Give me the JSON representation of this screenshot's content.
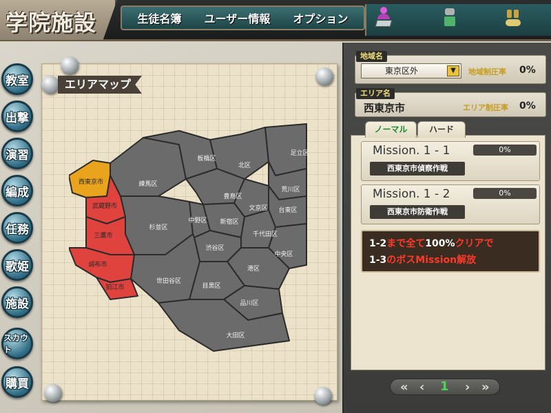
{
  "app": {
    "title": "学院施設"
  },
  "top_menu": {
    "items": [
      "生徒名簿",
      "ユーザー情報",
      "オプション"
    ]
  },
  "side_menu": {
    "items": [
      "教室",
      "出撃",
      "演習",
      "編成",
      "任務",
      "歌姫",
      "施設",
      "スカウト",
      "購買"
    ]
  },
  "map": {
    "label": "エリアマップ",
    "regions": [
      "西東京市",
      "武蔵野市",
      "三鷹市",
      "調布市",
      "狛江市",
      "練馬区",
      "杉並区",
      "世田谷区",
      "板橋区",
      "北区",
      "足立区",
      "荒川区",
      "豊島区",
      "文京区",
      "台東区",
      "中野区",
      "新宿区",
      "千代田区",
      "中央区",
      "渋谷区",
      "港区",
      "目黒区",
      "品川区",
      "大田区"
    ]
  },
  "region_panel": {
    "region_tag": "地域名",
    "region_value": "東京区外",
    "region_rate_label": "地域制圧率",
    "region_rate_value": "0%",
    "area_tag": "エリア名",
    "area_value": "西東京市",
    "area_rate_label": "エリア制圧率",
    "area_rate_value": "0%"
  },
  "tabs": {
    "normal": "ノーマル",
    "hard": "ハード",
    "separator": "|"
  },
  "missions": [
    {
      "title": "Mission. 1 - 1",
      "subtitle": "西東京市偵察作戦",
      "progress": "0%"
    },
    {
      "title": "Mission. 1 - 2",
      "subtitle": "西東京市防衛作戦",
      "progress": "0%"
    }
  ],
  "notice": {
    "line1_a": "1-2",
    "line1_b": "まで全て",
    "line1_c": "100%",
    "line1_d": "クリアで",
    "line2_a": "1-3",
    "line2_b": "のボスMission解放"
  },
  "pager": {
    "first": "«",
    "prev": "‹",
    "page": "1",
    "next": "›",
    "last": "»"
  },
  "colors": {
    "selected_region": "#e9a31c",
    "hostile_region": "#e0433e",
    "neutral_region": "#6b6b6b"
  }
}
